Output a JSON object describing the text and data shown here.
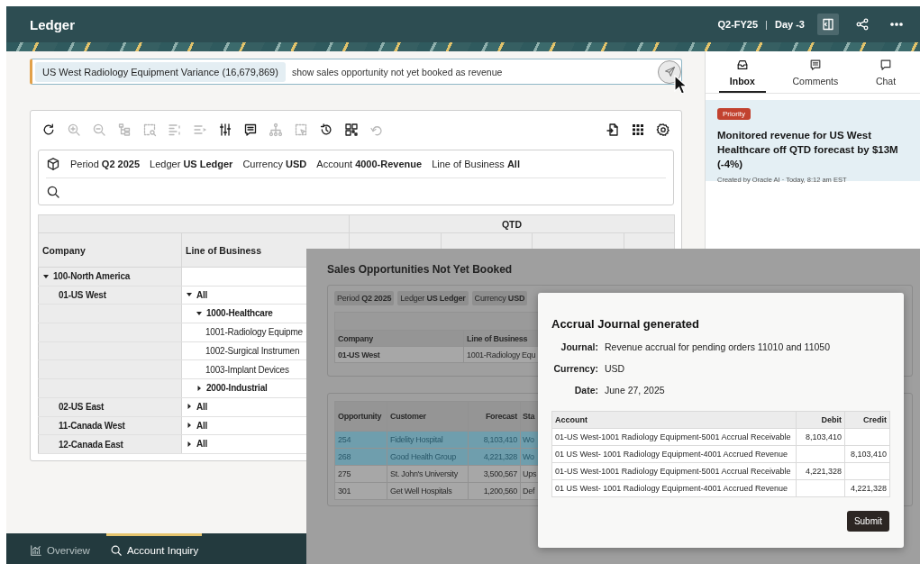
{
  "header": {
    "title": "Ledger",
    "period": "Q2-FY25",
    "separator": "|",
    "day": "Day -3",
    "actions": [
      {
        "kind": "panel",
        "selected": true
      },
      {
        "kind": "share",
        "selected": false
      },
      {
        "kind": "more",
        "selected": false
      }
    ]
  },
  "prompt": {
    "chip": "US West Radiology Equipment Variance (16,679,869)",
    "value": "show sales opportunity not yet booked as revenue"
  },
  "toolbar": {
    "left": [
      {
        "kind": "refresh",
        "disabled": false
      },
      {
        "kind": "zoom-in",
        "disabled": true
      },
      {
        "kind": "zoom-out",
        "disabled": true
      },
      {
        "kind": "hierarchy",
        "disabled": true
      },
      {
        "kind": "select-area",
        "disabled": true
      },
      {
        "kind": "align",
        "disabled": true
      },
      {
        "kind": "indent",
        "disabled": true
      },
      {
        "kind": "sliders",
        "disabled": false
      },
      {
        "kind": "comment",
        "disabled": false
      },
      {
        "kind": "tree",
        "disabled": true
      },
      {
        "kind": "dashed-select",
        "disabled": true
      },
      {
        "kind": "history",
        "disabled": false
      },
      {
        "kind": "grid",
        "disabled": false
      },
      {
        "kind": "undo",
        "disabled": true
      }
    ],
    "right": [
      {
        "kind": "export",
        "disabled": false
      },
      {
        "kind": "apps",
        "disabled": false
      },
      {
        "kind": "settings",
        "disabled": false
      }
    ]
  },
  "filters": [
    "Period **Q2 2025**",
    "Ledger **US Ledger**",
    "Currency **USD**",
    "Account **4000-Revenue**",
    "Line of Business **All**"
  ],
  "table": {
    "group_header": "QTD",
    "columns": [
      "Company",
      "Line of Business"
    ],
    "rows": [
      {
        "company": "100-North America",
        "expanded": true,
        "children": [
          {
            "company": "01-US West",
            "lines": [
              {
                "label": "All",
                "expanded": true,
                "children": [
                  {
                    "label": "1000-Healthcare",
                    "expanded": true,
                    "children": [
                      {
                        "label": "1001-Radiology Equipme"
                      },
                      {
                        "label": "1002-Surgical Instrumen"
                      },
                      {
                        "label": "1003-Implant Devices"
                      }
                    ]
                  },
                  {
                    "label": "2000-Industrial",
                    "expanded": false
                  }
                ]
              }
            ]
          },
          {
            "company": "02-US East",
            "lines": [
              {
                "label": "All",
                "expanded": false
              }
            ]
          },
          {
            "company": "11-Canada West",
            "lines": [
              {
                "label": "All",
                "expanded": false
              }
            ]
          },
          {
            "company": "12-Canada East",
            "lines": [
              {
                "label": "All",
                "expanded": false
              }
            ]
          }
        ]
      }
    ]
  },
  "bottom_nav": [
    {
      "kind": "chart",
      "label": "Overview",
      "selected": false
    },
    {
      "kind": "search",
      "label": "Account Inquiry",
      "selected": true
    }
  ],
  "side_panel": {
    "tabs": [
      {
        "kind": "inbox",
        "label": "Inbox",
        "selected": true
      },
      {
        "kind": "comment",
        "label": "Comments",
        "selected": false
      },
      {
        "kind": "chat",
        "label": "Chat",
        "selected": false
      }
    ],
    "notification": {
      "badge": "Priority",
      "title": "Monitored revenue for US West Healthcare off QTD forecast by $13M (-4%)",
      "meta": "Created by Oracle AI · Today, 8:12 am EST"
    }
  },
  "overlay": {
    "title": "Sales Opportunities Not Yet Booked",
    "chips": [
      "Period **Q2 2025**",
      "Ledger **US Ledger**",
      "Currency **USD**"
    ],
    "context_table": {
      "columns": [
        "Company",
        "Line of Business"
      ],
      "rows": [
        [
          "01-US West",
          "1001-Radiology Equ"
        ]
      ]
    },
    "opportunities": {
      "columns": [
        "Opportunity",
        "Customer",
        "Forecast",
        "Sta"
      ],
      "rows": [
        {
          "cells": [
            "254",
            "Fidelity Hospital",
            "8,103,410",
            "Wo"
          ],
          "selected": true
        },
        {
          "cells": [
            "268",
            "Good Health Group",
            "4,221,328",
            "Wo"
          ],
          "selected": true
        },
        {
          "cells": [
            "275",
            "St. John's University",
            "3,500,567",
            "Ups"
          ],
          "selected": false
        },
        {
          "cells": [
            "301",
            "Get Well Hospitals",
            "1,200,560",
            "Def"
          ],
          "selected": false
        }
      ]
    }
  },
  "dialog": {
    "title": "Accrual Journal generated",
    "fields": [
      {
        "label": "Journal:",
        "value": "Revenue accrual for pending orders 11010 and 11050"
      },
      {
        "label": "Currency:",
        "value": "USD"
      },
      {
        "label": "Date:",
        "value": "June 27, 2025"
      }
    ],
    "table": {
      "columns": [
        "Account",
        "Debit",
        "Credit"
      ],
      "rows": [
        {
          "account": "01-US West-1001 Radiology Equipment-5001 Accrual Receivable",
          "debit": "8,103,410"
        },
        {
          "account": "01 US West- 1001 Radiology Equipment-4001 Accrued Revenue",
          "credit": "8,103,410"
        },
        {
          "account": "01-US West-1001 Radiology Equipment-5001 Accrual Receivable",
          "debit": "4,221,328"
        },
        {
          "account": "01 US West- 1001 Radiology Equipment-4001 Accrued Revenue",
          "credit": "4,221,328"
        }
      ]
    },
    "submit": "Submit"
  }
}
